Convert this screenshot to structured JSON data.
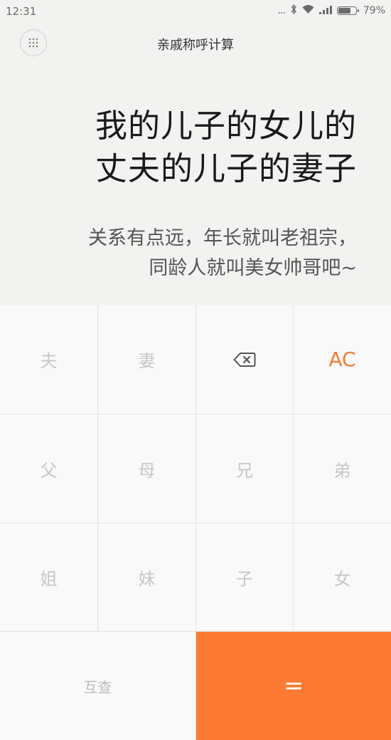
{
  "status_bar": {
    "time": "12:31",
    "dots": "...",
    "battery_percent": "79%",
    "battery_level": 0.79
  },
  "header": {
    "title": "亲戚称呼计算"
  },
  "display": {
    "expression_line1": "我的儿子的女儿的",
    "expression_line2": "丈夫的儿子的妻子",
    "result_line1": "关系有点远，年长就叫老祖宗，",
    "result_line2": "同龄人就叫美女帅哥吧~"
  },
  "keys": {
    "husband": "夫",
    "wife": "妻",
    "clear": "AC",
    "father": "父",
    "mother": "母",
    "elder_brother": "兄",
    "younger_brother": "弟",
    "elder_sister": "姐",
    "younger_sister": "妹",
    "son": "子",
    "daughter": "女",
    "mutual": "互查",
    "equals": "="
  },
  "colors": {
    "accent": "#fc7a31",
    "key_text": "#c7c7c7",
    "background": "#f2f2f0"
  }
}
